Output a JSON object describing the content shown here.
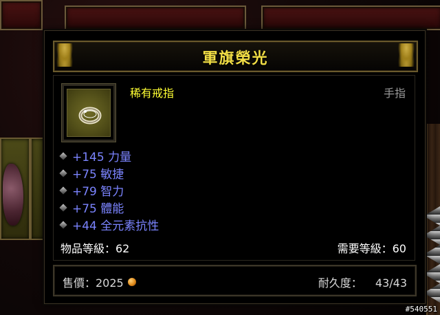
{
  "tooltip": {
    "title": "軍旗榮光",
    "item_name": "稀有戒指",
    "slot_type": "手指",
    "stats": [
      "+145 力量",
      "+75 敏捷",
      "+79 智力",
      "+75 體能",
      "+44 全元素抗性"
    ],
    "item_level_label": "物品等級：62",
    "required_level_label": "需要等級：60",
    "price_label": "售價：2025",
    "durability_label": "耐久度：",
    "durability_value": "43/43",
    "icon": "ring-icon",
    "colors": {
      "title": "#f2de45",
      "item_name": "#ffff33",
      "stat": "#7b84ff",
      "slot_type": "#9a9a9a"
    }
  },
  "watermark": "#540551"
}
